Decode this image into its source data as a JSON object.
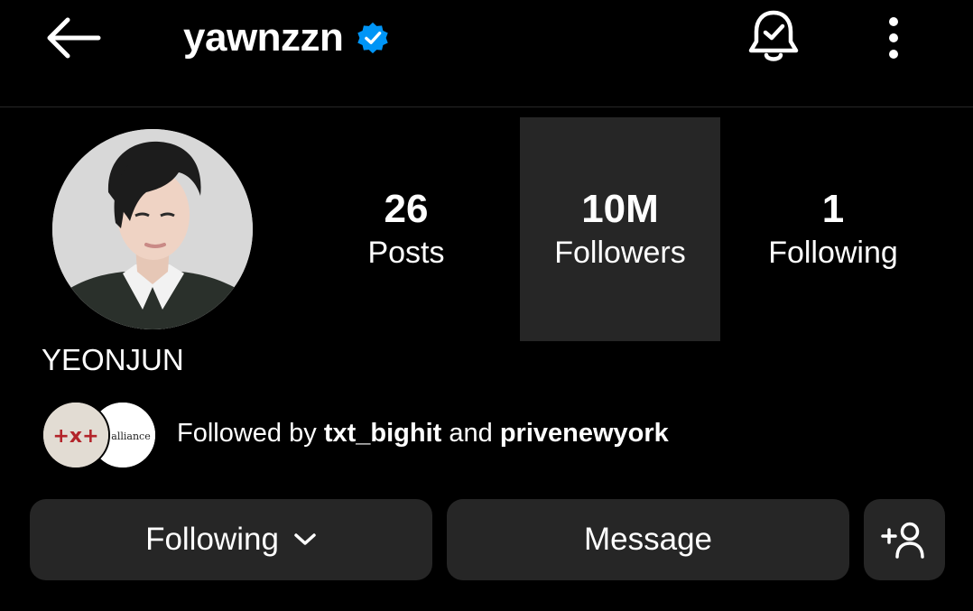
{
  "header": {
    "username": "yawnzzn",
    "verified": true,
    "back_icon": "arrow-left-icon",
    "bell_icon": "bell-check-icon",
    "more_icon": "more-vertical-icon"
  },
  "profile": {
    "display_name": "YEONJUN"
  },
  "stats": [
    {
      "value": "26",
      "label": "Posts"
    },
    {
      "value": "10M",
      "label": "Followers"
    },
    {
      "value": "1",
      "label": "Following"
    }
  ],
  "followed_by": {
    "prefix": "Followed by",
    "user1": "txt_bighit",
    "conj": "and",
    "user2": "privenewyork",
    "avatar1_text": "+x+",
    "avatar2_text": "é alliance"
  },
  "buttons": {
    "following": "Following",
    "message": "Message",
    "add_user_icon": "add-person-icon"
  },
  "colors": {
    "background": "#000000",
    "surface": "#262626",
    "verified_blue": "#0095f6"
  }
}
